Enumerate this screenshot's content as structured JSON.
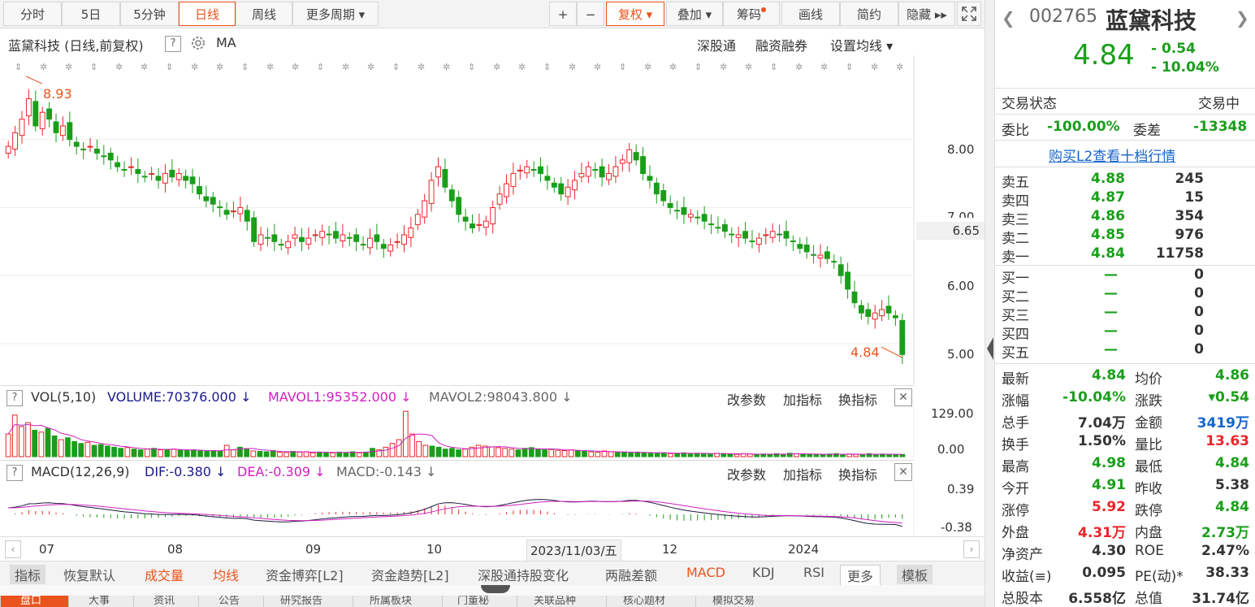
{
  "toolbar": {
    "items": [
      "分时",
      "5日",
      "5分钟",
      "日线",
      "周线",
      "更多周期 ▾"
    ],
    "right_items": [
      "+",
      "−",
      "复权 ▾",
      "叠加 ▾",
      "筹码",
      "画线",
      "简约",
      "隐藏 ▸▸"
    ]
  },
  "chart_header": {
    "title": "蓝黛科技 (日线,前复权)",
    "help": "?",
    "indicator": "MA",
    "links": [
      "深股通",
      "融资融券",
      "设置均线 ▾"
    ]
  },
  "price_axis": {
    "labels": [
      "8.00",
      "7.00",
      "6.65",
      "6.00",
      "5.00"
    ]
  },
  "annotations": {
    "high": "8.93",
    "low": "4.84"
  },
  "volume_panel": {
    "help": "?",
    "label": "VOL(5,10)",
    "volume": "VOLUME:70376.000",
    "mavol1": "MAVOL1:95352.000",
    "mavol2": "MAVOL2:98043.800",
    "axis": [
      "129.00",
      "0.00"
    ],
    "actions": [
      "改参数",
      "加指标",
      "换指标"
    ]
  },
  "macd_panel": {
    "help": "?",
    "label": "MACD(12,26,9)",
    "dif": "DIF:-0.380",
    "dea": "DEA:-0.309",
    "macd": "MACD:-0.143",
    "axis": [
      "0.39",
      "-0.38"
    ],
    "actions": [
      "改参数",
      "加指标",
      "换指标"
    ]
  },
  "time_axis": {
    "labels": [
      "07",
      "08",
      "09",
      "10",
      "12",
      "2024"
    ],
    "cursor": "2023/11/03/五"
  },
  "bottom_bar": {
    "items": [
      "指标",
      "恢复默认",
      "成交量",
      "均线",
      "资金博弈[L2]",
      "资金趋势[L2]",
      "深股通持股变化",
      "两融差额",
      "MACD",
      "KDJ",
      "RSI",
      "更多",
      "模板"
    ]
  },
  "bottom_tabs": [
    "盘口",
    "大事",
    "资讯",
    "公告",
    "研究报告",
    "所属板块",
    "门董秘",
    "关联品种",
    "核心题材",
    "模拟交易"
  ],
  "quote": {
    "code": "002765",
    "name": "蓝黛科技",
    "price": "4.84",
    "change": "- 0.54",
    "change_pct": "- 10.04%",
    "status_label": "交易状态",
    "status_value": "交易中",
    "weibi_label": "委比",
    "weibi": "-100.00%",
    "weicha_label": "委差",
    "weicha": "-13348",
    "l2_link": "购买L2查看十档行情"
  },
  "order_book": {
    "sells": [
      {
        "label": "卖五",
        "price": "4.88",
        "vol": "245"
      },
      {
        "label": "卖四",
        "price": "4.87",
        "vol": "15"
      },
      {
        "label": "卖三",
        "price": "4.86",
        "vol": "354"
      },
      {
        "label": "卖二",
        "price": "4.85",
        "vol": "976"
      },
      {
        "label": "卖一",
        "price": "4.84",
        "vol": "11758"
      }
    ],
    "buys": [
      {
        "label": "买一",
        "price": "—",
        "vol": "0"
      },
      {
        "label": "买二",
        "price": "—",
        "vol": "0"
      },
      {
        "label": "买三",
        "price": "—",
        "vol": "0"
      },
      {
        "label": "买四",
        "price": "—",
        "vol": "0"
      },
      {
        "label": "买五",
        "price": "—",
        "vol": "0"
      }
    ]
  },
  "stats": [
    {
      "l1": "最新",
      "v1": "4.84",
      "c1": "green",
      "l2": "均价",
      "v2": "4.86",
      "c2": "green"
    },
    {
      "l1": "涨幅",
      "v1": "-10.04%",
      "c1": "green",
      "l2": "涨跌",
      "v2": "▾0.54",
      "c2": "green"
    },
    {
      "l1": "总手",
      "v1": "7.04万",
      "c1": "dark",
      "l2": "金额",
      "v2": "3419万",
      "c2": "blue"
    },
    {
      "l1": "换手",
      "v1": "1.50%",
      "c1": "dark",
      "l2": "量比",
      "v2": "13.63",
      "c2": "red"
    },
    {
      "l1": "最高",
      "v1": "4.98",
      "c1": "green",
      "l2": "最低",
      "v2": "4.84",
      "c2": "green"
    },
    {
      "l1": "今开",
      "v1": "4.91",
      "c1": "green",
      "l2": "昨收",
      "v2": "5.38",
      "c2": "dark"
    },
    {
      "l1": "涨停",
      "v1": "5.92",
      "c1": "red",
      "l2": "跌停",
      "v2": "4.84",
      "c2": "green"
    },
    {
      "l1": "外盘",
      "v1": "4.31万",
      "c1": "red",
      "l2": "内盘",
      "v2": "2.73万",
      "c2": "green"
    },
    {
      "l1": "净资产",
      "v1": "4.30",
      "c1": "dark",
      "l2": "ROE",
      "v2": "2.47%",
      "c2": "dark"
    },
    {
      "l1": "收益(≡)",
      "v1": "0.095",
      "c1": "dark",
      "l2": "PE(动)*",
      "v2": "38.33",
      "c2": "dark"
    },
    {
      "l1": "总股本",
      "v1": "6.558亿",
      "c1": "dark",
      "l2": "总值",
      "v2": "31.74亿",
      "c2": "dark"
    }
  ],
  "colors": {
    "up": "#e8262a",
    "down": "#1a9e1a",
    "accent": "#e9541d",
    "ma_pink": "#d020c0"
  },
  "price_series": [
    7.9,
    8.1,
    8.3,
    8.6,
    8.2,
    8.4,
    8.3,
    8.1,
    8.2,
    8.0,
    7.9,
    7.85,
    7.9,
    7.8,
    7.75,
    7.7,
    7.6,
    7.55,
    7.6,
    7.5,
    7.45,
    7.5,
    7.4,
    7.5,
    7.45,
    7.5,
    7.4,
    7.35,
    7.2,
    7.1,
    7.05,
    7.0,
    6.9,
    6.95,
    7.0,
    6.8,
    6.5,
    6.6,
    6.55,
    6.5,
    6.45,
    6.5,
    6.6,
    6.5,
    6.55,
    6.6,
    6.65,
    6.6,
    6.55,
    6.6,
    6.55,
    6.5,
    6.45,
    6.55,
    6.5,
    6.4,
    6.45,
    6.5,
    6.6,
    6.7,
    6.9,
    7.1,
    7.4,
    7.6,
    7.3,
    7.1,
    6.9,
    6.8,
    6.7,
    6.75,
    6.8,
    7.0,
    7.2,
    7.35,
    7.5,
    7.55,
    7.6,
    7.55,
    7.5,
    7.4,
    7.3,
    7.2,
    7.3,
    7.4,
    7.5,
    7.6,
    7.55,
    7.45,
    7.5,
    7.6,
    7.7,
    7.85,
    7.7,
    7.5,
    7.4,
    7.2,
    7.1,
    7.0,
    6.95,
    6.9,
    6.9,
    6.85,
    6.8,
    6.75,
    6.7,
    6.65,
    6.6,
    6.6,
    6.55,
    6.5,
    6.55,
    6.6,
    6.65,
    6.6,
    6.55,
    6.5,
    6.4,
    6.35,
    6.3,
    6.3,
    6.25,
    6.2,
    6.0,
    5.8,
    5.6,
    5.45,
    5.4,
    5.45,
    5.5,
    5.45,
    5.38,
    4.84
  ],
  "volume_series": [
    60,
    110,
    80,
    90,
    70,
    65,
    75,
    55,
    45,
    50,
    40,
    35,
    38,
    30,
    32,
    28,
    25,
    22,
    24,
    20,
    18,
    20,
    22,
    18,
    19,
    20,
    17,
    16,
    18,
    15,
    14,
    16,
    15,
    30,
    18,
    25,
    20,
    15,
    14,
    13,
    16,
    12,
    11,
    14,
    12,
    13,
    10,
    12,
    11,
    10,
    12,
    11,
    13,
    10,
    12,
    22,
    18,
    25,
    35,
    45,
    120,
    60,
    40,
    30,
    28,
    25,
    20,
    22,
    18,
    20,
    25,
    30,
    28,
    26,
    24,
    22,
    20,
    18,
    22,
    24,
    20,
    18,
    19,
    17,
    16,
    18,
    15,
    14,
    13,
    12,
    15,
    13,
    12,
    11,
    10,
    12,
    11,
    10,
    9,
    10,
    8,
    9,
    10,
    8,
    9,
    8,
    7,
    9,
    8,
    7,
    6,
    8,
    7,
    6,
    7,
    6,
    8,
    6,
    9,
    8,
    7,
    6,
    5,
    6,
    7,
    8,
    6,
    7,
    6,
    5,
    8,
    6,
    7,
    6,
    5,
    6
  ]
}
